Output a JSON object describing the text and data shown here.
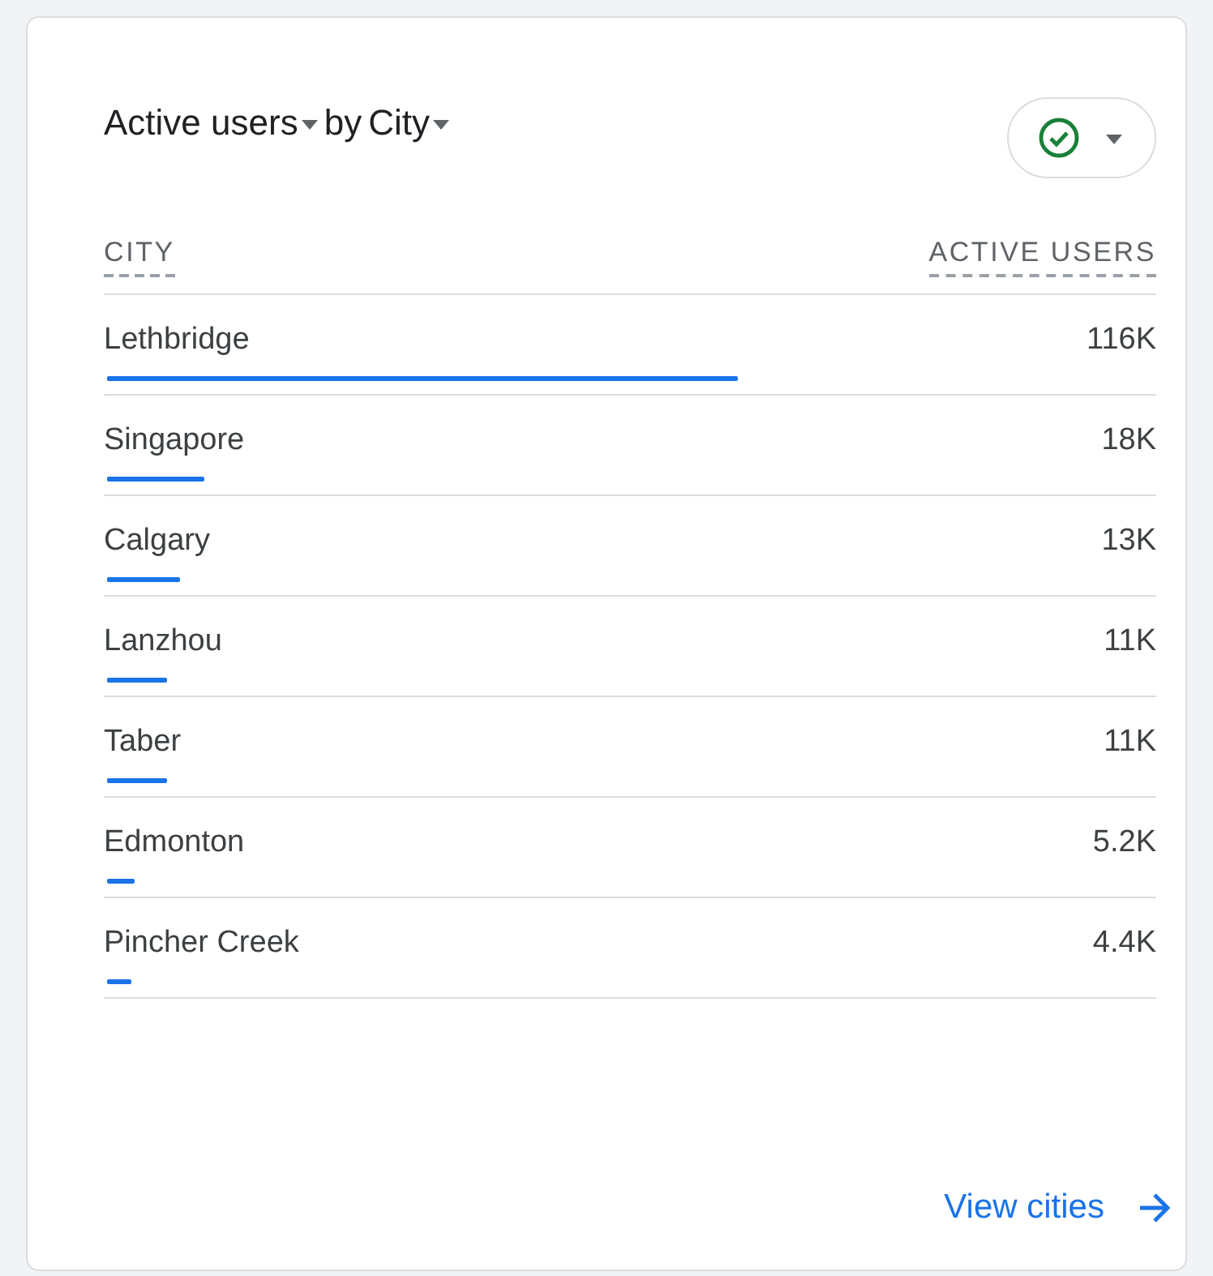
{
  "title": {
    "metric": "Active users",
    "connector": "by",
    "dimension": "City"
  },
  "table": {
    "columns": [
      "CITY",
      "ACTIVE USERS"
    ],
    "rows": [
      {
        "city": "Lethbridge",
        "value": "116K",
        "level": 0.6
      },
      {
        "city": "Singapore",
        "value": "18K",
        "level": 0.093
      },
      {
        "city": "Calgary",
        "value": "13K",
        "level": 0.069
      },
      {
        "city": "Lanzhou",
        "value": "11K",
        "level": 0.057
      },
      {
        "city": "Taber",
        "value": "11K",
        "level": 0.057
      },
      {
        "city": "Edmonton",
        "value": "5.2K",
        "level": 0.027
      },
      {
        "city": "Pincher Creek",
        "value": "4.4K",
        "level": 0.023
      }
    ]
  },
  "link": "View cities"
}
